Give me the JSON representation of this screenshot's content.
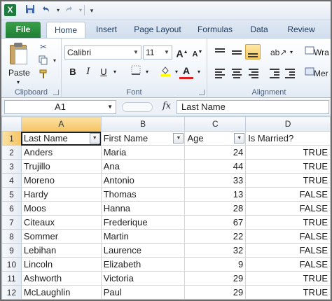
{
  "qat": {
    "app_icon": "X",
    "save_icon": "save-icon",
    "undo_icon": "undo-icon",
    "redo_icon": "redo-icon"
  },
  "tabs": [
    {
      "label": "File"
    },
    {
      "label": "Home"
    },
    {
      "label": "Insert"
    },
    {
      "label": "Page Layout"
    },
    {
      "label": "Formulas"
    },
    {
      "label": "Data"
    },
    {
      "label": "Review"
    }
  ],
  "ribbon": {
    "clipboard": {
      "label": "Clipboard",
      "paste_label": "Paste"
    },
    "font": {
      "label": "Font",
      "font_name": "Calibri",
      "font_size": "11",
      "bold": "B",
      "italic": "I",
      "underline": "U",
      "grow": "A",
      "shrink": "A",
      "font_color_letter": "A"
    },
    "alignment": {
      "label": "Alignment",
      "wrap_partial": "Wra",
      "merge_partial": "Mer"
    }
  },
  "formula_bar": {
    "name_box": "A1",
    "fx": "fx",
    "value": "Last Name"
  },
  "grid": {
    "columns": [
      "A",
      "B",
      "C",
      "D"
    ],
    "header_row": [
      "Last Name",
      "First Name",
      "Age",
      "Is Married?"
    ],
    "rows": [
      [
        "Anders",
        "Maria",
        "24",
        "TRUE"
      ],
      [
        "Trujillo",
        "Ana",
        "44",
        "TRUE"
      ],
      [
        "Moreno",
        "Antonio",
        "33",
        "TRUE"
      ],
      [
        "Hardy",
        "Thomas",
        "13",
        "FALSE"
      ],
      [
        "Moos",
        "Hanna",
        "28",
        "FALSE"
      ],
      [
        "Citeaux",
        "Frederique",
        "67",
        "TRUE"
      ],
      [
        "Sommer",
        "Martin",
        "22",
        "FALSE"
      ],
      [
        "Lebihan",
        "Laurence",
        "32",
        "FALSE"
      ],
      [
        "Lincoln",
        "Elizabeth",
        "9",
        "FALSE"
      ],
      [
        "Ashworth",
        "Victoria",
        "29",
        "TRUE"
      ],
      [
        "McLaughlin",
        "Paul",
        "29",
        "TRUE"
      ]
    ],
    "row_numbers": [
      "1",
      "2",
      "3",
      "4",
      "5",
      "6",
      "7",
      "8",
      "9",
      "10",
      "11",
      "12"
    ]
  }
}
